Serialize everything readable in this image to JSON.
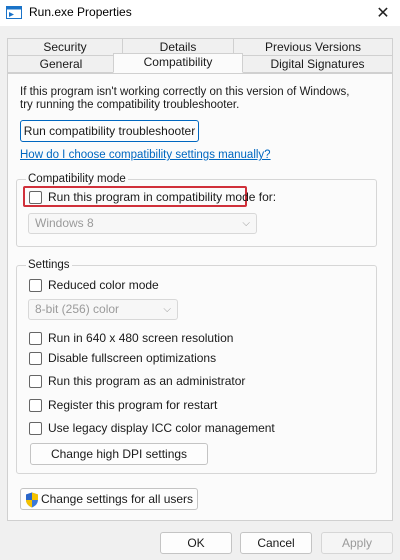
{
  "window": {
    "title": "Run.exe Properties",
    "close_glyph": "✕"
  },
  "tabs": {
    "row1": [
      {
        "label": "Security"
      },
      {
        "label": "Details"
      },
      {
        "label": "Previous Versions"
      }
    ],
    "row2": [
      {
        "label": "General"
      },
      {
        "label": "Compatibility",
        "active": true
      },
      {
        "label": "Digital Signatures"
      }
    ]
  },
  "compat": {
    "intro": "If this program isn't working correctly on this version of Windows, try running the compatibility troubleshooter.",
    "troubleshooter_button": "Run compatibility troubleshooter",
    "manual_link": "How do I choose compatibility settings manually?",
    "mode_group_label": "Compatibility mode",
    "mode_checkbox_label": "Run this program in compatibility mode for:",
    "mode_select_value": "Windows 8",
    "settings_group_label": "Settings",
    "reduced_color_label": "Reduced color mode",
    "color_select_value": "8-bit (256) color",
    "options": [
      "Run in 640 x 480 screen resolution",
      "Disable fullscreen optimizations",
      "Run this program as an administrator",
      "Register this program for restart",
      "Use legacy display ICC color management"
    ],
    "dpi_button": "Change high DPI settings",
    "all_users_button": "Change settings for all users"
  },
  "footer": {
    "ok": "OK",
    "cancel": "Cancel",
    "apply": "Apply"
  },
  "colors": {
    "accent": "#0067c0",
    "highlight_border": "#d0303a",
    "panel_bg": "#fbfbfb",
    "window_bg": "#f0f0f0"
  },
  "icons": {
    "title": "app-window-icon",
    "close": "close-icon",
    "select_chevron": "chevron-down-icon",
    "admin": "uac-shield-icon"
  }
}
